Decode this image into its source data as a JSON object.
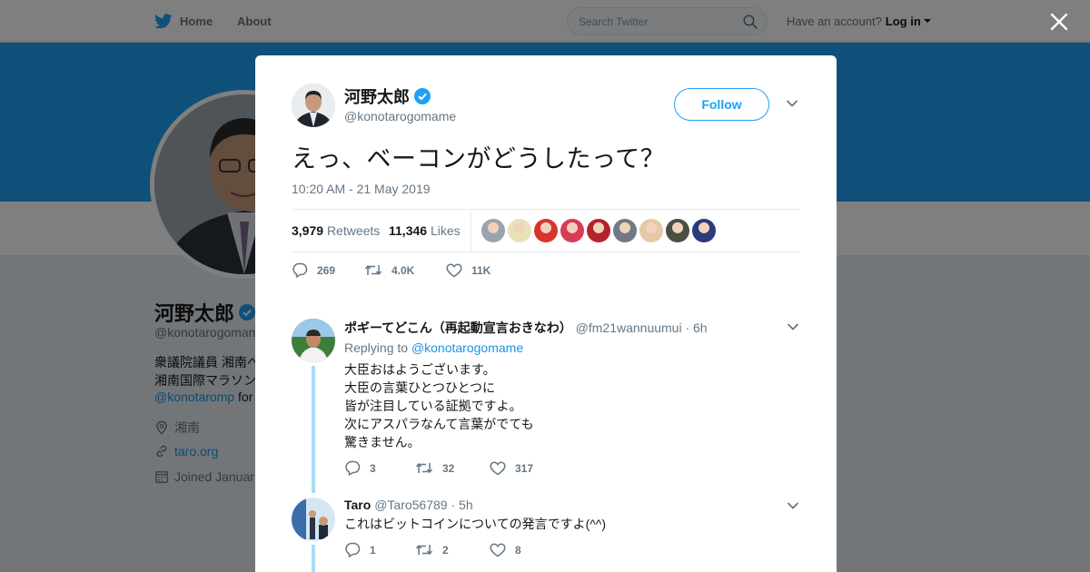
{
  "topbar": {
    "home_label": "Home",
    "about_label": "About",
    "search_placeholder": "Search Twitter",
    "have_account": "Have an account?",
    "login_label": "Log in"
  },
  "profile": {
    "name": "河野太郎",
    "handle": "@konotarogomame",
    "bio_line1": "衆議院議員 湘南へ",
    "bio_line2": "湘南国際マラソン",
    "bio_link": "@konotaromp",
    "bio_link_suffix": " for",
    "location": "湘南",
    "url": "taro.org",
    "joined": "Joined Januar"
  },
  "tweet": {
    "author_name": "河野太郎",
    "author_handle": "@konotarogomame",
    "follow_label": "Follow",
    "text": "えっ、ベーコンがどうしたって？",
    "timestamp": "10:20 AM - 21 May 2019",
    "retweets_count": "3,979",
    "retweets_label": "Retweets",
    "likes_count": "11,346",
    "likes_label": "Likes",
    "reply_count": "269",
    "retweet_count_short": "4.0K",
    "like_count_short": "11K",
    "liker_avatar_colors": [
      "#9aa4ad",
      "#e9e1b8",
      "#d9342b",
      "#d93a55",
      "#b5232b",
      "#6f7a86",
      "#e5c9a4",
      "#4a4f45",
      "#2b3a7a"
    ]
  },
  "replies": [
    {
      "name": "ポギーてどこん（再起動宣言おきなわ）",
      "handle": "@fm21wannuumui",
      "time": "· 6h",
      "replying_prefix": "Replying to",
      "replying_to": "@konotarogomame",
      "lines": [
        "大臣おはようございます。",
        "大臣の言葉ひとつひとつに",
        "皆が注目している証拠ですよ。",
        "次にアスパラなんて言葉がでても",
        "驚きません。"
      ],
      "reply_count": "3",
      "retweet_count": "32",
      "like_count": "317"
    },
    {
      "name": "Taro",
      "handle": "@Taro56789",
      "time": "· 5h",
      "text": "これはビットコインについての発言ですよ(^^)",
      "reply_count": "1",
      "retweet_count": "2",
      "like_count": "8"
    }
  ],
  "colors": {
    "accent": "#1da1f2",
    "link": "#1b95e0",
    "thread_line": "#a7dcf8",
    "overlay": "rgba(0,0,0,0.5)"
  }
}
